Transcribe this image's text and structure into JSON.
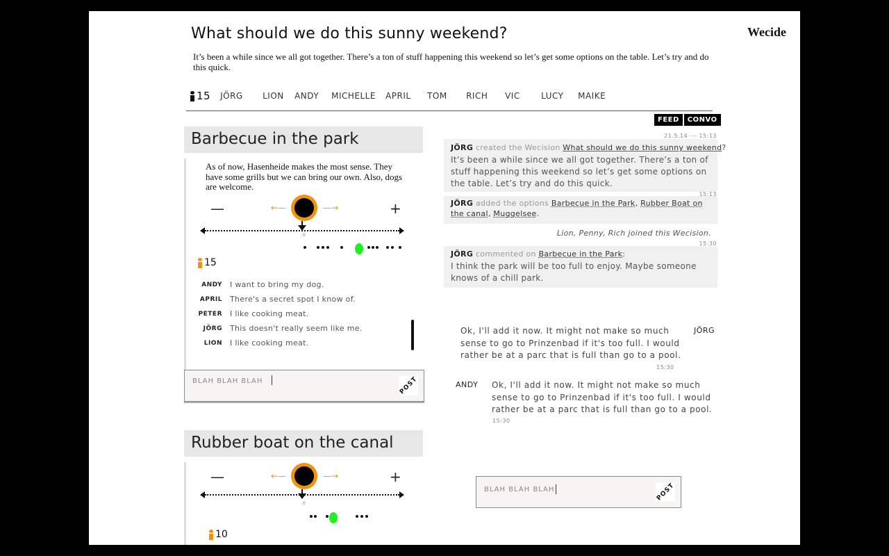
{
  "app": {
    "brand": "Wecide"
  },
  "decision": {
    "title": "What should we do this sunny weekend?",
    "intro": "It’s been a while since we all got together. There’s a ton of stuff happening this weekend so let’s get some options on the table.  Let’s try and do this quick."
  },
  "members": {
    "count": "15",
    "names": [
      "JÖRG",
      "LION",
      "ANDY",
      "MICHELLE",
      "APRIL",
      "TOM",
      "RICH",
      "VIC",
      "LUCY",
      "MAIKE"
    ]
  },
  "options": [
    {
      "title": "Barbecue in the park",
      "description": "As of now, Hasenheide makes the most sense. They have some grills but we can bring our own. Also, dogs are welcome.",
      "minus": "—",
      "plus": "+",
      "zero_label": "0",
      "participants": "15",
      "comments": [
        {
          "name": "ANDY",
          "text": "I want to bring my dog."
        },
        {
          "name": "APRIL",
          "text": "There's a secret spot I know of."
        },
        {
          "name": "PETER",
          "text": "I like cooking meat."
        },
        {
          "name": "JÖRG",
          "text": "This doesn't really seem like me."
        },
        {
          "name": "LION",
          "text": "I like cooking meat."
        }
      ],
      "input_placeholder": "BLAH BLAH BLAH",
      "post_label": "POST"
    },
    {
      "title": "Rubber boat on the canal",
      "minus": "—",
      "plus": "+",
      "zero_label": "0",
      "participants": "10"
    }
  ],
  "tabs": {
    "feed": "FEED",
    "convo": "CONVO"
  },
  "feed": [
    {
      "timestamp": "21.5.14 --- 15:13",
      "who": "JÖRG",
      "action": "created the Wecision",
      "link": "What should we do this sunny weekend",
      "suffix": "?",
      "body": "It’s been a while since we all got together. There’s a ton of stuff happening this weekend so let’s get some options on the table.  Let’s try and do this quick."
    },
    {
      "timestamp": "15:13",
      "who": "JÖRG",
      "action": "added the options",
      "links": [
        "Barbecue in the Park",
        "Rubber Boat on the canal",
        "Muggelsee"
      ],
      "separator": ", ",
      "suffix": "."
    },
    {
      "joined": "Lion, Penny, Rich joined this Wecision."
    },
    {
      "timestamp": "15:30",
      "who": "JÖRG",
      "action": "commented on",
      "link": "Barbecue in the Park",
      "suffix": ":",
      "body": "I think the park will be too full to enjoy. Maybe someone knows of a chill park."
    }
  ],
  "convo": [
    {
      "name": "JÖRG",
      "text": "Ok, I'll add it now. It might not make so much sense to go to Prinzenbad if it's too full. I would rather be at a parc that is full than go to a pool.",
      "time": "15:30"
    },
    {
      "name": "ANDY",
      "text": "Ok, I'll add it now. It might not make so much sense to go to Prinzenbad if it's too full. I would rather be at a parc that is full than go to a pool.",
      "time": "15:30"
    }
  ],
  "convo_input": {
    "placeholder": "BLAH BLAH BLAH",
    "post_label": "POST"
  }
}
